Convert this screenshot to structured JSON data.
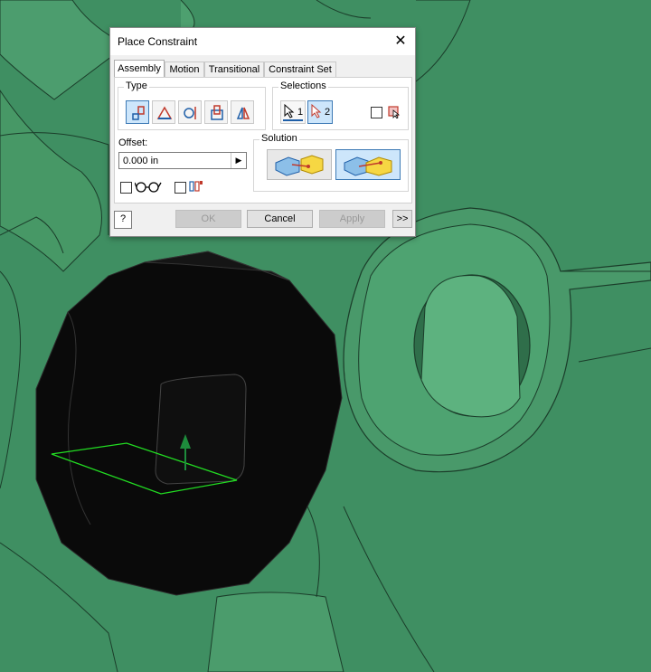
{
  "dialog": {
    "title": "Place Constraint",
    "tabs": [
      "Assembly",
      "Motion",
      "Transitional",
      "Constraint Set"
    ],
    "type_label": "Type",
    "selections_label": "Selections",
    "selection_1": "1",
    "selection_2": "2",
    "offset_label": "Offset:",
    "offset_value": "0.000 in",
    "solution_label": "Solution",
    "help_glyph": "?",
    "buttons": {
      "ok": "OK",
      "cancel": "Cancel",
      "apply": "Apply",
      "more": ">>"
    }
  },
  "colors": {
    "accent": "#3d7ab5",
    "part": "#3f8f62",
    "selected_face": "#0a0a0a",
    "highlight": "#22dd22"
  },
  "icons": [
    "close-icon",
    "mate-icon",
    "angle-icon",
    "tangent-icon",
    "insert-icon",
    "symmetry-icon",
    "select-cursor-icon",
    "pick-part-first-icon",
    "preview-icon",
    "predict-offset-icon",
    "mate-solution-icon",
    "flush-solution-icon",
    "help-icon"
  ]
}
